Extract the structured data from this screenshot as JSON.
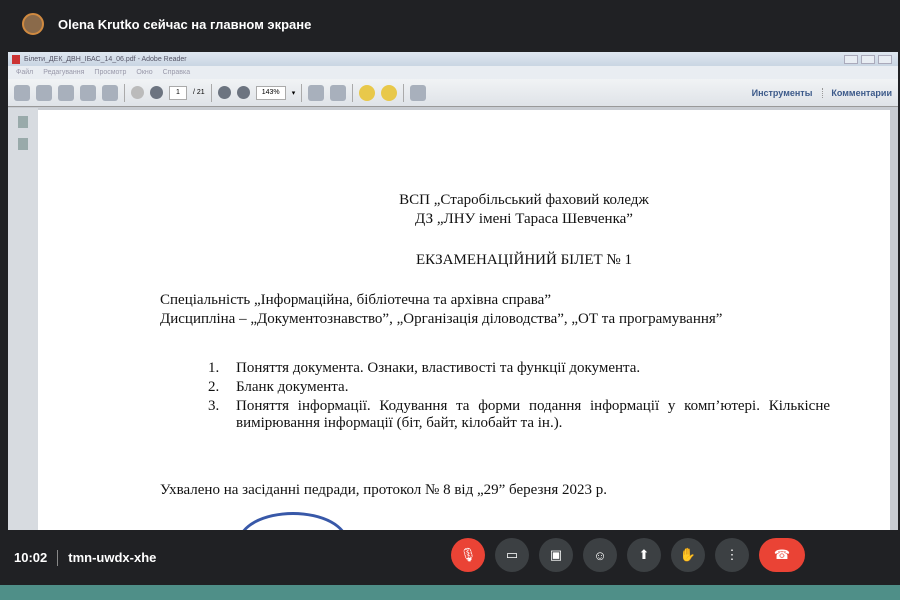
{
  "meet": {
    "presenter_text": "Olena Krutko сейчас на главном экране",
    "time": "10:02",
    "meeting_code": "tmn-uwdx-xhe"
  },
  "reader": {
    "title": "Білети_ДЕК_ДВН_ІБАС_14_06.pdf - Adobe Reader",
    "menu": [
      "Файл",
      "Редагування",
      "Просмотр",
      "Окно",
      "Справка"
    ],
    "page_current": "1",
    "page_total": "/ 21",
    "zoom": "143%",
    "tools_label": "Инструменты",
    "comments_label": "Комментарии"
  },
  "doc": {
    "org_line1": "ВСП „Старобільський фаховий коледж",
    "org_line2": "ДЗ „ЛНУ імені Тараса Шевченка”",
    "heading": "ЕКЗАМЕНАЦІЙНИЙ БІЛЕТ № 1",
    "specialty": "Спеціальність „Інформаційна, бібліотечна та архівна справа”",
    "discipline": "Дисципліна – „Документознавство”, „Організація діловодства”, „ОТ та програмування”",
    "questions": [
      {
        "n": "1.",
        "text": "Поняття документа. Ознаки, властивості та функції документа."
      },
      {
        "n": "2.",
        "text": "Бланк документа."
      },
      {
        "n": "3.",
        "text": "Поняття інформації. Кодування та форми подання інформації у комп’ютері. Кількісне вимірювання інформації (біт, байт, кілобайт та ін.)."
      }
    ],
    "approval": "Ухвалено на засіданні педради, протокол № 8 від „29” березня 2023 р."
  }
}
